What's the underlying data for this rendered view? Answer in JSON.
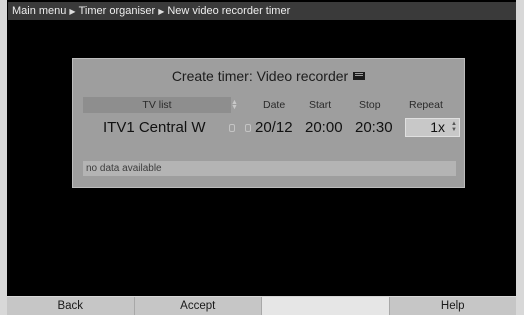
{
  "breadcrumb": {
    "item1": "Main menu",
    "item2": "Timer organiser",
    "item3": "New video recorder timer"
  },
  "dialog": {
    "title": "Create timer: Video recorder",
    "title_icon": "video-recorder-icon",
    "columns": {
      "tv_list": "TV list",
      "date": "Date",
      "start": "Start",
      "stop": "Stop",
      "repeat": "Repeat"
    },
    "row": {
      "channel": "ITV1 Central W",
      "date": "20/12",
      "start": "20:00",
      "stop": "20:30",
      "repeat": "1x"
    },
    "info": "no data available"
  },
  "softkeys": {
    "back": "Back",
    "accept": "Accept",
    "blank": "",
    "help": "Help"
  },
  "colors": {
    "dialog_bg": "#9e9e9e",
    "breadcrumb_bg": "#3a3a3a",
    "softkey_bg": "#c6c6c6"
  }
}
